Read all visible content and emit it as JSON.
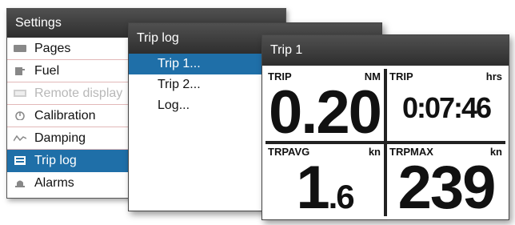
{
  "settings": {
    "title": "Settings",
    "items": [
      {
        "label": "Pages",
        "icon": "pages-icon"
      },
      {
        "label": "Fuel",
        "icon": "fuel-icon"
      },
      {
        "label": "Remote display",
        "icon": "remote-display-icon"
      },
      {
        "label": "Calibration",
        "icon": "calibration-icon"
      },
      {
        "label": "Damping",
        "icon": "damping-icon"
      },
      {
        "label": "Trip log",
        "icon": "trip-log-icon"
      },
      {
        "label": "Alarms",
        "icon": "alarms-icon"
      }
    ],
    "selected_index": 5,
    "disabled_index": 2
  },
  "triplog": {
    "title": "Trip log",
    "items": [
      "Trip 1...",
      "Trip 2...",
      "Log..."
    ],
    "selected_index": 0
  },
  "trip1": {
    "title": "Trip 1",
    "cells": [
      {
        "label": "TRIP",
        "unit": "NM",
        "value": "0.20"
      },
      {
        "label": "TRIP",
        "unit": "hrs",
        "value": "0:07:46"
      },
      {
        "label": "TRPAVG",
        "unit": "kn",
        "value_int": "1",
        "value_dec": ".6"
      },
      {
        "label": "TRPMAX",
        "unit": "kn",
        "value": "239"
      }
    ]
  },
  "colors": {
    "selected": "#1f6fa8",
    "header": "#3a3a3a"
  }
}
